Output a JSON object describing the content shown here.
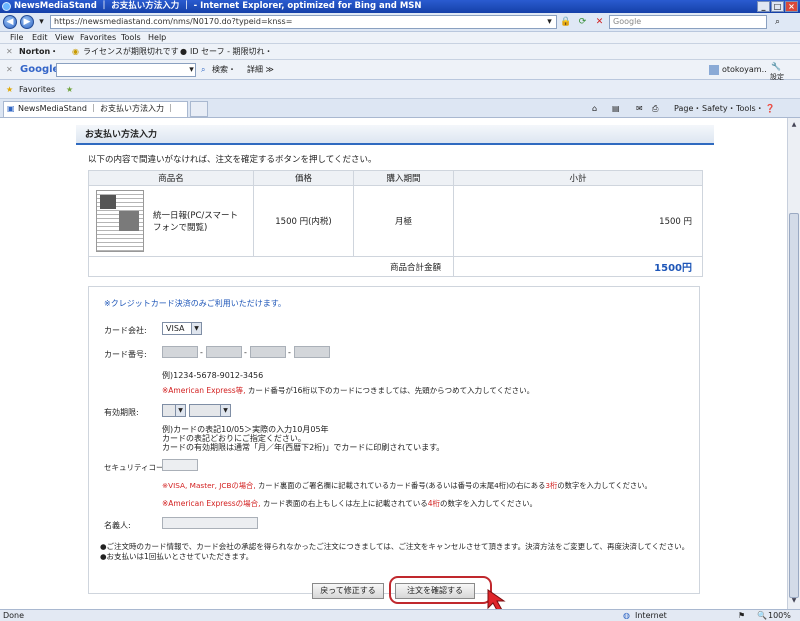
{
  "window": {
    "title": "NewsMediaStand ｜ お支払い方法入力 ｜ - Internet Explorer, optimized for Bing and MSN"
  },
  "address": {
    "url": "https://newsmediastand.com/nms/N0170.do?typeid=knss=",
    "search_placeholder": "Google"
  },
  "menu": [
    "File",
    "Edit",
    "View",
    "Favorites",
    "Tools",
    "Help"
  ],
  "norton": {
    "label": "Norton・",
    "license": "ライセンスが期限切れです・",
    "idsafe": "ID セーフ - 期限切れ・"
  },
  "google_bar": {
    "logo": "Google",
    "search": "検索・",
    "detail": "詳細 ≫",
    "user": "otokoyam..",
    "settings": "設定"
  },
  "favorites": {
    "label": "Favorites"
  },
  "tab": {
    "label": "NewsMediaStand ｜ お支払い方法入力 ｜"
  },
  "ie_toolbar": {
    "page": "Page・",
    "safety": "Safety・",
    "tools": "Tools・"
  },
  "page": {
    "section_title": "お支払い方法入力",
    "intro": "以下の内容で間違いがなければ、注文を確定するボタンを押してください。",
    "table": {
      "headers": [
        "商品名",
        "価格",
        "購入期間",
        "小計"
      ],
      "product_name": "統一日報(PC/スマートフォンで閲覧)",
      "price": "1500 円(内税)",
      "period": "月極",
      "subtotal": "1500 円",
      "total_label": "商品合計金額",
      "total_value": "1500円"
    },
    "card": {
      "note": "※クレジットカード決済のみご利用いただけます。",
      "company_label": "カード会社:",
      "company_value": "VISA",
      "number_label": "カード番号:",
      "number_example": "例)1234-5678-9012-3456",
      "amex_prefix": "※American Express等,",
      "amex_text": " カード番号が16桁以下のカードにつきましては、先頭からつめて入力してください。",
      "expiry_label": "有効期限:",
      "expiry_note1": "例)カードの表記10/05＞実際の入力10月05年",
      "expiry_note2": "カードの表記どおりにご指定ください。",
      "expiry_note3": "カードの有効期限は通常「月／年(西暦下2桁)」でカードに印刷されています。",
      "security_label": "セキュリティコード:",
      "security_note1_prefix": "※VISA, Master, JCBの場合,",
      "security_note1_text": " カード裏面のご署名欄に記載されているカード番号(あるいは番号の末尾4桁)の右にある",
      "security_note1_digits": "3桁",
      "security_note1_suffix": "の数字を入力してください。",
      "security_note2_prefix": "※American Expressの場合,",
      "security_note2_text": " カード表面の右上もしくは左上に記載されている",
      "security_note2_digits": "4桁",
      "security_note2_suffix": "の数字を入力してください。",
      "holder_label": "名義人:"
    },
    "footnote1": "●ご注文時のカード情報で、カード会社の承認を得られなかったご注文につきましては、ご注文をキャンセルさせて頂きます。決済方法をご変更して、再度決済してください。",
    "footnote2": "●お支払いは1回払いとさせていただきます。",
    "back_button": "戻って修正する",
    "confirm_button": "注文を確認する"
  },
  "status": {
    "left": "Done",
    "zone": "Internet",
    "zoom": "100%"
  }
}
